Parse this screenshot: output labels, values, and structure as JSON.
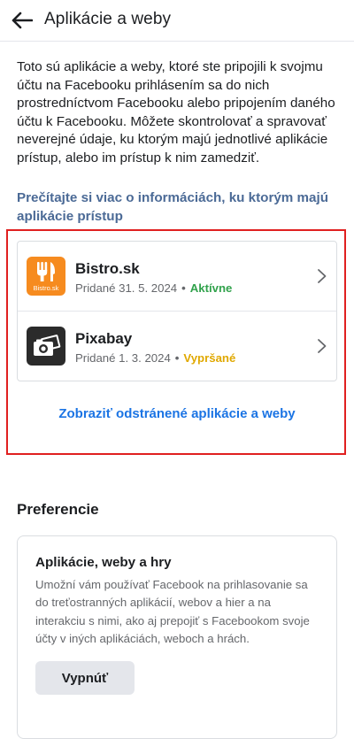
{
  "header": {
    "title": "Aplikácie a weby",
    "back_icon": "arrow-left-icon"
  },
  "intro_text": "Toto sú aplikácie a weby, ktoré ste pripojili k svojmu účtu na Facebooku prihlásením sa do nich prostredníctvom Facebooku alebo pripojením daného účtu k Facebooku. Môžete skontrolovať a spravovať neverejné údaje, ku ktorým majú jednotlivé aplikácie prístup, alebo im prístup k nim zamedziť.",
  "learn_more_link": "Prečítajte si viac o informáciách, ku ktorým majú aplikácie prístup",
  "apps": [
    {
      "name": "Bistro.sk",
      "added": "Pridané 31. 5. 2024",
      "status": "Aktívne",
      "status_color": "#31a24c",
      "logo_text": "Bistro.sk",
      "logo_bg": "#f68b1f",
      "logo_icon": "fork-knife-icon"
    },
    {
      "name": "Pixabay",
      "added": "Pridané 1. 3. 2024",
      "status": "Vypršané",
      "status_color": "#e0a800",
      "logo_bg": "#2b2b2b",
      "logo_icon": "camera-photos-icon"
    }
  ],
  "removed_link": "Zobraziť odstránené aplikácie a weby",
  "preferences": {
    "heading": "Preferencie",
    "card_title": "Aplikácie, weby a hry",
    "card_desc": "Umožní vám používať Facebook na prihlasovanie sa do treťostranných aplikácií, webov a hier a na interakciu s nimi, ako aj prepojiť s Facebookom svoje účty v iných aplikáciách, weboch a hrách.",
    "button_label": "Vypnúť"
  },
  "colors": {
    "link_blue": "#1b74e4",
    "learn_link": "#4b6a96",
    "highlight_border": "#e02020"
  }
}
